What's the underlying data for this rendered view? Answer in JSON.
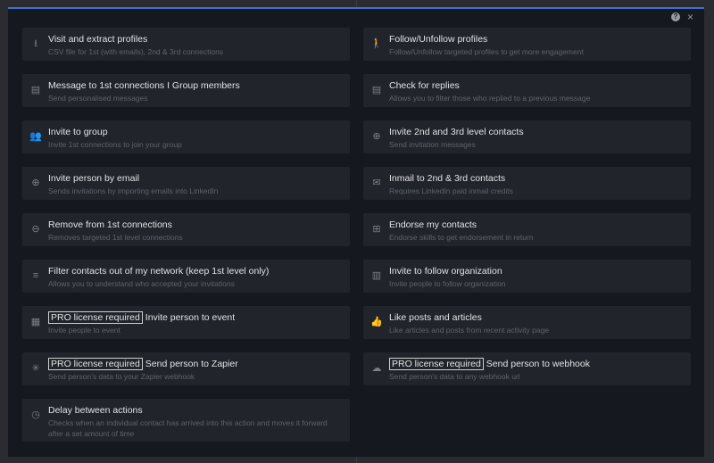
{
  "header": {
    "help_icon": "?",
    "close_icon": "×"
  },
  "pro_label": "PRO license required",
  "left": [
    {
      "icon": "download-icon",
      "glyph": "⭳",
      "title": "Visit and extract profiles",
      "subtitle": "CSV file for 1st (with emails), 2nd & 3rd connections"
    },
    {
      "icon": "message-icon",
      "glyph": "▤",
      "title": "Message to 1st connections I Group members",
      "subtitle": "Send personalised messages"
    },
    {
      "icon": "group-icon",
      "glyph": "👥",
      "title": "Invite to group",
      "subtitle": "Invite 1st connections to join your group"
    },
    {
      "icon": "person-add-icon",
      "glyph": "⊕",
      "title": "Invite person by email",
      "subtitle": "Sends invitations by importing emails into LinkedIn"
    },
    {
      "icon": "person-remove-icon",
      "glyph": "⊖",
      "title": "Remove from 1st connections",
      "subtitle": "Removes targeted 1st level connections"
    },
    {
      "icon": "filter-icon",
      "glyph": "≡",
      "title": "Filter contacts out of my network (keep 1st level only)",
      "subtitle": "Allows you to understand who accepted your invitations"
    },
    {
      "icon": "calendar-icon",
      "glyph": "▦",
      "pro": true,
      "title": "Invite person to event",
      "subtitle": "Invite people to event"
    },
    {
      "icon": "zapier-icon",
      "glyph": "✳",
      "pro": true,
      "title": "Send person to Zapier",
      "subtitle": "Send person's data to your Zapier webhook"
    },
    {
      "icon": "timer-icon",
      "glyph": "◷",
      "title": "Delay between actions",
      "subtitle": "Checks when an individual contact has arrived into this action and moves it forward after a set amount of time"
    }
  ],
  "right": [
    {
      "icon": "walk-icon",
      "glyph": "🚶",
      "title": "Follow/Unfollow profiles",
      "subtitle": "Follow/Unfollow targeted profiles to get more engagement"
    },
    {
      "icon": "replies-icon",
      "glyph": "▤",
      "title": "Check for replies",
      "subtitle": "Allows you to filter those who replied to a previous message"
    },
    {
      "icon": "person-add-icon",
      "glyph": "⊕",
      "title": "Invite 2nd and 3rd level contacts",
      "subtitle": "Send invitation messages"
    },
    {
      "icon": "mail-icon",
      "glyph": "✉",
      "title": "Inmail to 2nd & 3rd contacts",
      "subtitle": "Requires LinkedIn paid inmail credits"
    },
    {
      "icon": "plus-box-icon",
      "glyph": "⊞",
      "title": "Endorse my contacts",
      "subtitle": "Endorse skills to get endorsement in return"
    },
    {
      "icon": "building-icon",
      "glyph": "▥",
      "title": "Invite to follow organization",
      "subtitle": "Invite people to follow organization"
    },
    {
      "icon": "thumbs-up-icon",
      "glyph": "👍",
      "title": "Like posts and articles",
      "subtitle": "Like articles and posts from recent activity page"
    },
    {
      "icon": "cloud-upload-icon",
      "glyph": "☁",
      "pro": true,
      "title": "Send person to webhook",
      "subtitle": "Send person's data to any webhook url"
    }
  ]
}
